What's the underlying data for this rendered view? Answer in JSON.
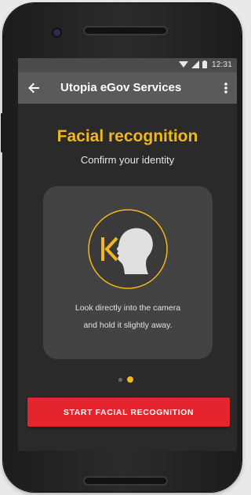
{
  "status_bar": {
    "time": "12:31",
    "icons": [
      "wifi-icon",
      "signal-icon",
      "battery-icon"
    ]
  },
  "app_bar": {
    "title": "Utopia eGov Services",
    "back_icon": "arrow-left-icon",
    "menu_icon": "more-vertical-icon"
  },
  "main": {
    "title": "Facial recognition",
    "subtitle": "Confirm your identity",
    "card": {
      "illustration_icon": "face-scan-icon",
      "hint_line_1": "Look directly into the camera",
      "hint_line_2": "and hold it slightly away."
    },
    "pager": {
      "total": 2,
      "active_index": 1
    },
    "cta_label": "START FACIAL RECOGNITION"
  },
  "colors": {
    "accent": "#f2b81b",
    "cta": "#e5252e",
    "app_bar": "#5a5a5a",
    "status_bar": "#4b4b4b",
    "screen_bg": "#2a2a2a",
    "card_bg": "#434343"
  }
}
